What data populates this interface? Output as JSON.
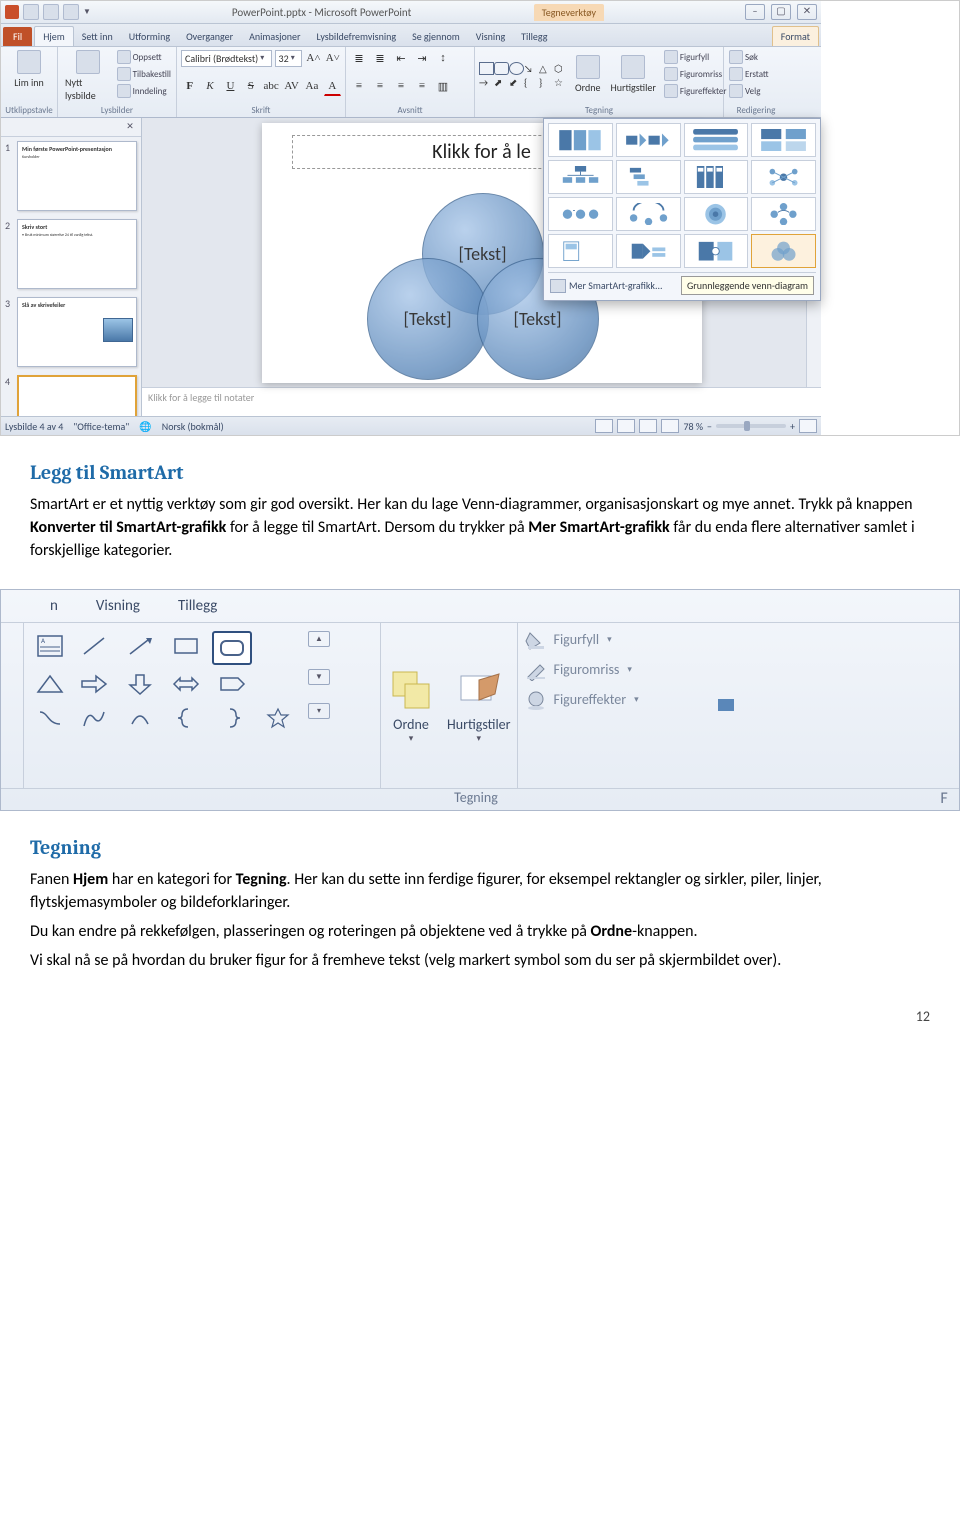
{
  "pp": {
    "title": "PowerPoint.pptx - Microsoft PowerPoint",
    "contextual_tab": "Tegneverktøy",
    "tabs": {
      "file": "Fil",
      "home": "Hjem",
      "insert": "Sett inn",
      "design": "Utforming",
      "transitions": "Overganger",
      "animations": "Animasjoner",
      "slideshow": "Lysbildefremvisning",
      "review": "Se gjennom",
      "view": "Visning",
      "addins": "Tillegg",
      "format": "Format"
    },
    "ribbon": {
      "paste": "Lim inn",
      "clipboard": "Utklippstavle",
      "newslide": "Nytt lysbilde",
      "layout": "Oppsett",
      "reset": "Tilbakestill",
      "section": "Inndeling",
      "slides_group": "Lysbilder",
      "font_name": "Calibri (Brødtekst)",
      "font_size": "32",
      "font_group": "Skrift",
      "paragraph_group": "Avsnitt",
      "arrange": "Ordne",
      "quickstyles": "Hurtigstiler",
      "shapefill": "Figurfyll",
      "shapeoutline": "Figuromriss",
      "shapeeffects": "Figureffekter",
      "drawing_group": "Tegning",
      "find": "Søk",
      "replace": "Erstatt",
      "select": "Velg",
      "editing_group": "Redigering"
    },
    "gallery": {
      "more": "Mer SmartArt-grafikk...",
      "tooltip": "Grunnleggende venn-diagram"
    },
    "thumbs": {
      "t1_title": "Min første PowerPoint-presentasjon",
      "t1_sub": "Kursholder",
      "t2_title": "Skriv stort",
      "t2_body": "• Bruk minimum størrelse 24 til vanlig tekst.",
      "t3_title": "Slå av skrivefeiler",
      "t4_title": ""
    },
    "slide": {
      "title_placeholder": "Klikk for å le",
      "venn_text": "[Tekst]"
    },
    "notes_placeholder": "Klikk for å legge til notater",
    "status": {
      "slide": "Lysbilde 4 av 4",
      "theme": "\"Office-tema\"",
      "lang": "Norsk (bokmål)",
      "zoom": "78 %"
    }
  },
  "tg": {
    "tabs": {
      "n": "n",
      "view": "Visning",
      "addins": "Tillegg"
    },
    "arrange": "Ordne",
    "quickstyles": "Hurtigstiler",
    "shapefill": "Figurfyll",
    "shapeoutline": "Figuromriss",
    "shapeeffects": "Figureffekter",
    "group_label": "Tegning"
  },
  "doc": {
    "h1": "Legg til SmartArt",
    "p1a": "SmartArt er et nyttig verktøy som gir god oversikt. Her kan du lage Venn-diagrammer, organisasjonskart og mye annet. Trykk på knappen ",
    "p1b_bold": "Konverter til SmartArt-grafikk",
    "p1c": " for å legge til SmartArt. Dersom du trykker på ",
    "p1d_bold": "Mer SmartArt-grafikk",
    "p1e": " får du enda flere alternativer samlet i forskjellige kategorier.",
    "h2": "Tegning",
    "p2a": "Fanen ",
    "p2b_bold": "Hjem",
    "p2c": " har en kategori for ",
    "p2d_bold": "Tegning",
    "p2e": ". Her kan du sette inn ferdige figurer, for eksempel rektangler og sirkler, piler, linjer, flytskjemasymboler og bildeforklaringer.",
    "p3a": "Du kan endre på rekkefølgen, plasseringen og roteringen på objektene ved å trykke på ",
    "p3b_bold": "Ordne",
    "p3c": "-knappen.",
    "p4": "Vi skal nå se på hvordan du bruker figur for å fremheve tekst (velg markert symbol som du ser på skjermbildet over).",
    "pagenum": "12"
  }
}
